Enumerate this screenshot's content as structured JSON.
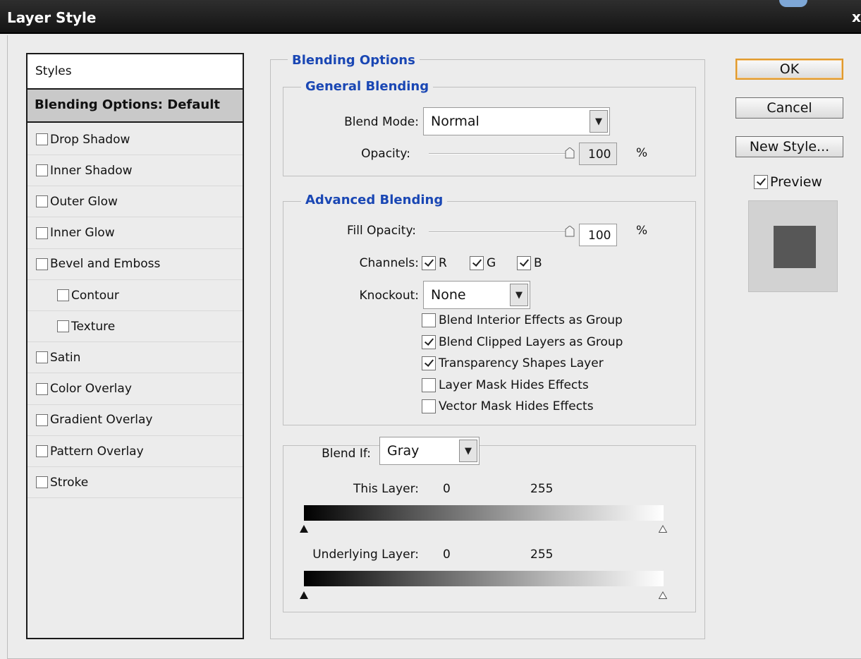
{
  "window": {
    "title": "Layer Style",
    "close_glyph": "x"
  },
  "styles_panel": {
    "header": "Styles",
    "selected": "Blending Options: Default",
    "items": [
      {
        "label": "Drop Shadow",
        "checked": false,
        "indent": false
      },
      {
        "label": "Inner Shadow",
        "checked": false,
        "indent": false
      },
      {
        "label": "Outer Glow",
        "checked": false,
        "indent": false
      },
      {
        "label": "Inner Glow",
        "checked": false,
        "indent": false
      },
      {
        "label": "Bevel and Emboss",
        "checked": false,
        "indent": false
      },
      {
        "label": "Contour",
        "checked": false,
        "indent": true
      },
      {
        "label": "Texture",
        "checked": false,
        "indent": true
      },
      {
        "label": "Satin",
        "checked": false,
        "indent": false
      },
      {
        "label": "Color Overlay",
        "checked": false,
        "indent": false
      },
      {
        "label": "Gradient Overlay",
        "checked": false,
        "indent": false
      },
      {
        "label": "Pattern Overlay",
        "checked": false,
        "indent": false
      },
      {
        "label": "Stroke",
        "checked": false,
        "indent": false
      }
    ]
  },
  "blending": {
    "title": "Blending Options",
    "general": {
      "title": "General Blending",
      "blend_mode_label": "Blend Mode:",
      "blend_mode_value": "Normal",
      "opacity_label": "Opacity:",
      "opacity_value": "100",
      "opacity_unit": "%",
      "opacity_fraction": 1.0
    },
    "advanced": {
      "title": "Advanced Blending",
      "fill_opacity_label": "Fill Opacity:",
      "fill_opacity_value": "100",
      "fill_opacity_unit": "%",
      "fill_opacity_fraction": 1.0,
      "channels_label": "Channels:",
      "channels": [
        {
          "label": "R",
          "checked": true
        },
        {
          "label": "G",
          "checked": true
        },
        {
          "label": "B",
          "checked": true
        }
      ],
      "knockout_label": "Knockout:",
      "knockout_value": "None",
      "options": [
        {
          "label": "Blend Interior Effects as Group",
          "checked": false
        },
        {
          "label": "Blend Clipped Layers as Group",
          "checked": true
        },
        {
          "label": "Transparency Shapes Layer",
          "checked": true
        },
        {
          "label": "Layer Mask Hides Effects",
          "checked": false
        },
        {
          "label": "Vector Mask Hides Effects",
          "checked": false
        }
      ]
    },
    "blend_if": {
      "label": "Blend If:",
      "value": "Gray",
      "this_layer_label": "This Layer:",
      "this_layer_low": "0",
      "this_layer_high": "255",
      "underlying_label": "Underlying Layer:",
      "underlying_low": "0",
      "underlying_high": "255"
    }
  },
  "buttons": {
    "ok": "OK",
    "cancel": "Cancel",
    "new_style": "New Style...",
    "preview_label": "Preview",
    "preview_checked": true
  },
  "colors": {
    "title_bar": "#1f1f1f",
    "legend_blue": "#1a47b4",
    "dialog_bg": "#ececec",
    "default_button_border": "#e09a2d",
    "preview_swatch": "#575757"
  },
  "icons": {
    "dropdown": "chevron-down-icon",
    "slider_thumb": "slider-thumb-icon",
    "black_point": "triangle-filled-icon",
    "white_point": "triangle-outline-icon",
    "checkbox": "checkbox-icon"
  }
}
